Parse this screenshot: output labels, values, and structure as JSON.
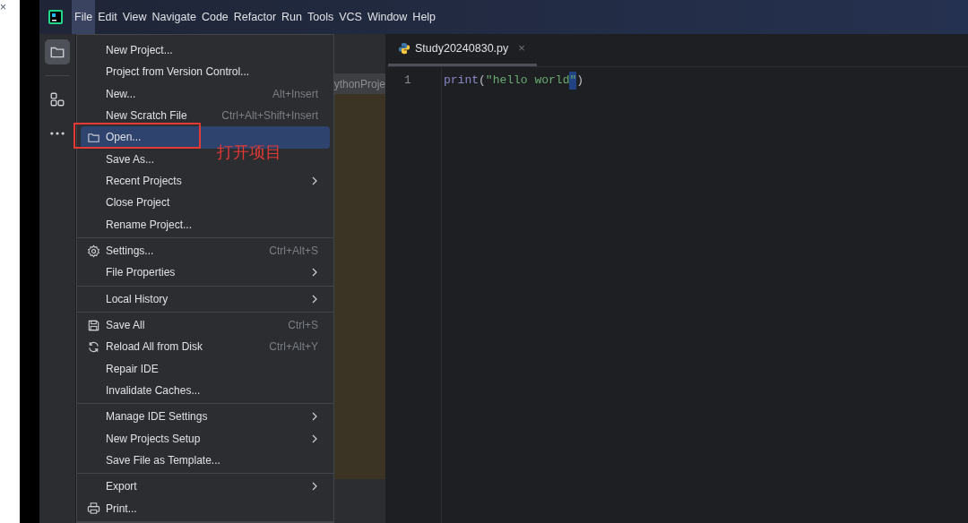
{
  "outside": {
    "close_glyph": "×"
  },
  "menu_bar": [
    {
      "label": "File",
      "selected": true
    },
    {
      "label": "Edit",
      "selected": false
    },
    {
      "label": "View",
      "selected": false
    },
    {
      "label": "Navigate",
      "selected": false
    },
    {
      "label": "Code",
      "selected": false
    },
    {
      "label": "Refactor",
      "selected": false
    },
    {
      "label": "Run",
      "selected": false
    },
    {
      "label": "Tools",
      "selected": false
    },
    {
      "label": "VCS",
      "selected": false
    },
    {
      "label": "Window",
      "selected": false
    },
    {
      "label": "Help",
      "selected": false
    }
  ],
  "tool_strip": [
    {
      "selected": true
    },
    {
      "selected": false
    },
    {
      "selected": false
    }
  ],
  "project_panel": {
    "title": "ythonProje"
  },
  "file_menu": {
    "sections": [
      [
        {
          "label": "New Project...",
          "selected": false
        },
        {
          "label": "Project from Version Control...",
          "selected": false
        },
        {
          "label": "New...",
          "shortcut": "Alt+Insert",
          "selected": false
        },
        {
          "label": "New Scratch File",
          "shortcut": "Ctrl+Alt+Shift+Insert",
          "selected": false
        },
        {
          "label": "Open...",
          "selected": true
        },
        {
          "label": "Save As...",
          "selected": false
        },
        {
          "label": "Recent Projects",
          "submenu": true,
          "selected": false
        },
        {
          "label": "Close Project",
          "selected": false
        },
        {
          "label": "Rename Project...",
          "selected": false
        }
      ],
      [
        {
          "label": "Settings...",
          "shortcut": "Ctrl+Alt+S",
          "selected": false
        },
        {
          "label": "File Properties",
          "submenu": true,
          "selected": false
        }
      ],
      [
        {
          "label": "Local History",
          "submenu": true,
          "selected": false
        }
      ],
      [
        {
          "label": "Save All",
          "shortcut": "Ctrl+S",
          "selected": false
        },
        {
          "label": "Reload All from Disk",
          "shortcut": "Ctrl+Alt+Y",
          "selected": false
        },
        {
          "label": "Repair IDE",
          "selected": false
        },
        {
          "label": "Invalidate Caches...",
          "selected": false
        }
      ],
      [
        {
          "label": "Manage IDE Settings",
          "submenu": true,
          "selected": false
        },
        {
          "label": "New Projects Setup",
          "submenu": true,
          "selected": false
        },
        {
          "label": "Save File as Template...",
          "selected": false
        }
      ],
      [
        {
          "label": "Export",
          "submenu": true,
          "selected": false
        },
        {
          "label": "Print...",
          "selected": false
        }
      ]
    ]
  },
  "editor": {
    "tabs": [
      {
        "label": "Study20240830.py",
        "close": "×",
        "selected": true
      }
    ],
    "lines": [
      {
        "number": "1",
        "tokens": [
          {
            "text": "print",
            "kind": "builtin",
            "selected": false
          },
          {
            "text": "(",
            "kind": "punct",
            "selected": false
          },
          {
            "text": "\"hello world",
            "kind": "string",
            "selected": false
          },
          {
            "text": "\"",
            "kind": "string",
            "selected": true
          },
          {
            "text": ")",
            "kind": "punct",
            "selected": false
          }
        ]
      }
    ]
  },
  "annotation": {
    "text": "打开项目"
  }
}
